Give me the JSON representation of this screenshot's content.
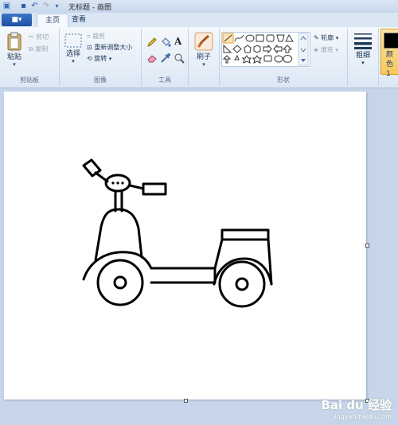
{
  "window": {
    "title": "无标题 - 画图"
  },
  "tabs": {
    "app_menu": "■▾",
    "home": "主页",
    "view": "查看"
  },
  "clipboard": {
    "paste": "粘贴",
    "cut": "剪切",
    "copy": "复制",
    "group": "剪贴板"
  },
  "image": {
    "select": "选择",
    "crop": "裁剪",
    "resize": "重新调整大小",
    "rotate": "旋转",
    "group": "图像"
  },
  "tools": {
    "group": "工具"
  },
  "brushes": {
    "label": "刷子"
  },
  "shapes": {
    "outline": "轮廓",
    "fill": "填充",
    "group": "形状"
  },
  "size": {
    "label": "粗细"
  },
  "colors": {
    "color1_label": "颜色1"
  },
  "watermark": {
    "brand": "Bai du 经验",
    "url": "jingyan.baidu.com"
  },
  "icons": [
    "save-icon",
    "undo-icon",
    "redo-icon",
    "paste-icon",
    "cut-icon",
    "copy-icon",
    "select-icon",
    "crop-icon",
    "resize-icon",
    "rotate-icon",
    "pencil-icon",
    "fill-icon",
    "text-icon",
    "eraser-icon",
    "color-picker-icon",
    "magnifier-icon",
    "brush-icon",
    "outline-icon",
    "fill-shape-icon",
    "size-icon"
  ]
}
